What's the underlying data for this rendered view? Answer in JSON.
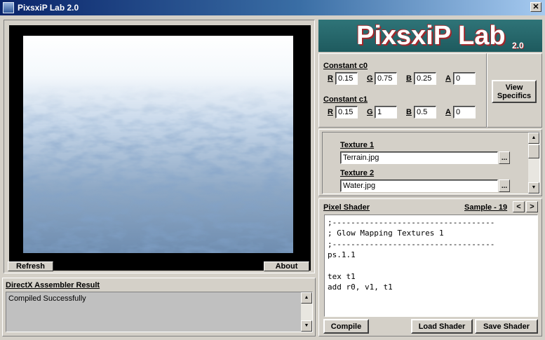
{
  "window": {
    "title": "PixsxiP Lab 2.0",
    "close_glyph": "✕"
  },
  "viewport": {
    "refresh_label": "Refresh",
    "about_label": "About"
  },
  "assembler": {
    "title": "DirectX Assembler Result",
    "result": "Compiled Successfully"
  },
  "logo": {
    "text": "PixsxiP Lab",
    "version": "2.0"
  },
  "constants": {
    "c0": {
      "title": "Constant c0",
      "r": "0.15",
      "g": "0.75",
      "b": "0.25",
      "a": "0"
    },
    "c1": {
      "title": "Constant c1",
      "r": "0.15",
      "g": "1",
      "b": "0.5",
      "a": "0"
    },
    "labels": {
      "r": "R",
      "g": "G",
      "b": "B",
      "a": "A"
    },
    "view_specifics_label": "View Specifics"
  },
  "textures": {
    "t1": {
      "title": "Texture 1",
      "value": "Terrain.jpg"
    },
    "t2": {
      "title": "Texture 2",
      "value": "Water.jpg"
    },
    "browse_label": "..."
  },
  "shader": {
    "title": "Pixel Shader",
    "sample": "Sample - 19",
    "prev": "<",
    "next": ">",
    "code": ";-----------------------------------\n; Glow Mapping Textures 1\n;-----------------------------------\nps.1.1\n\ntex t1\nadd r0, v1, t1",
    "compile_label": "Compile",
    "load_label": "Load Shader",
    "save_label": "Save Shader"
  },
  "colors": {
    "title_gradient_start": "#0a246a",
    "logo_bg": "#2a6a6e",
    "logo_text": "#ffffff",
    "logo_shadow": "#a0272b",
    "face": "#d4d0c8"
  }
}
